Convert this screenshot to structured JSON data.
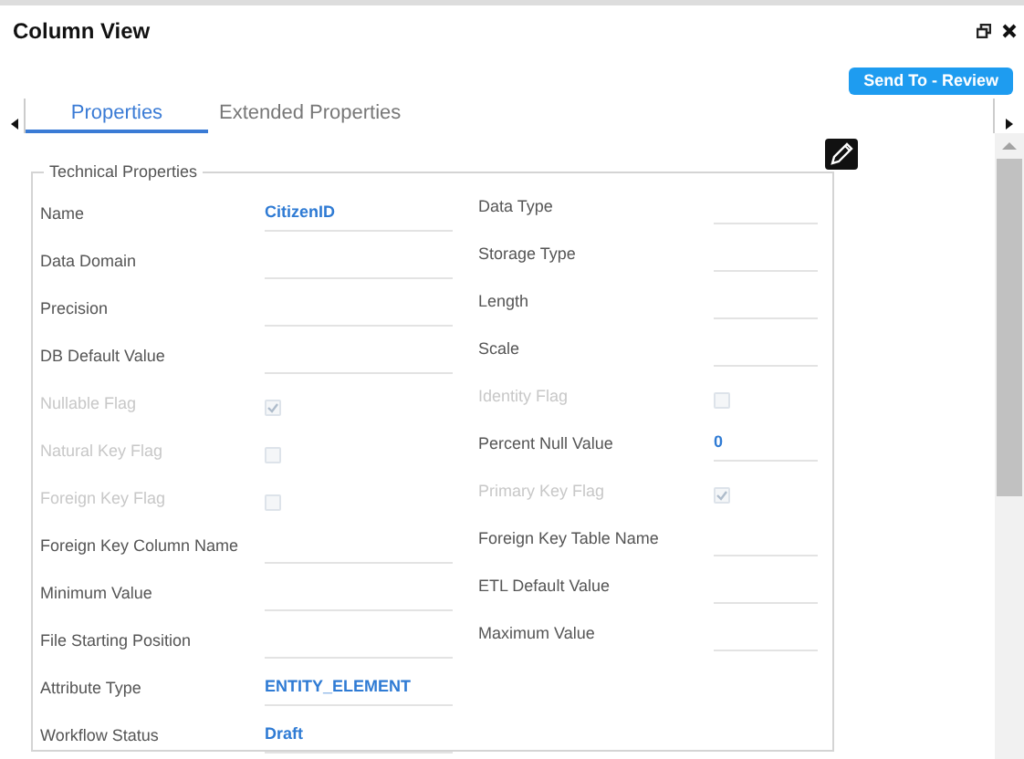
{
  "window": {
    "title": "Column View"
  },
  "send_button": {
    "label": "Send To - Review"
  },
  "tabs": [
    {
      "label": "Properties",
      "selected": true
    },
    {
      "label": "Extended Properties",
      "selected": false
    }
  ],
  "fieldset": {
    "legend": "Technical Properties",
    "left": [
      {
        "kind": "text",
        "label": "Name",
        "value": "CitizenID"
      },
      {
        "kind": "text",
        "label": "Data Domain"
      },
      {
        "kind": "text",
        "label": "Precision"
      },
      {
        "kind": "text",
        "label": "DB Default Value"
      },
      {
        "kind": "checkbox",
        "label": "Nullable Flag",
        "checked": true,
        "disabled": true
      },
      {
        "kind": "checkbox",
        "label": "Natural Key Flag",
        "checked": false,
        "disabled": true
      },
      {
        "kind": "checkbox",
        "label": "Foreign Key Flag",
        "checked": false,
        "disabled": true
      },
      {
        "kind": "text",
        "label": "Foreign Key Column Name"
      },
      {
        "kind": "text",
        "label": "Minimum Value"
      },
      {
        "kind": "text",
        "label": "File Starting Position"
      },
      {
        "kind": "text",
        "label": "Attribute Type",
        "value": "ENTITY_ELEMENT"
      },
      {
        "kind": "text",
        "label": "Workflow Status",
        "value": "Draft"
      }
    ],
    "right": [
      {
        "kind": "text",
        "label": "Data Type"
      },
      {
        "kind": "text",
        "label": "Storage Type"
      },
      {
        "kind": "text",
        "label": "Length"
      },
      {
        "kind": "text",
        "label": "Scale"
      },
      {
        "kind": "checkbox",
        "label": "Identity Flag",
        "checked": false,
        "disabled": true
      },
      {
        "kind": "text",
        "label": "Percent Null Value",
        "value": "0"
      },
      {
        "kind": "checkbox",
        "label": "Primary Key Flag",
        "checked": true,
        "disabled": true
      },
      {
        "kind": "text",
        "label": "Foreign Key Table Name"
      },
      {
        "kind": "text",
        "label": "ETL Default Value"
      },
      {
        "kind": "text",
        "label": "Maximum Value"
      }
    ]
  }
}
